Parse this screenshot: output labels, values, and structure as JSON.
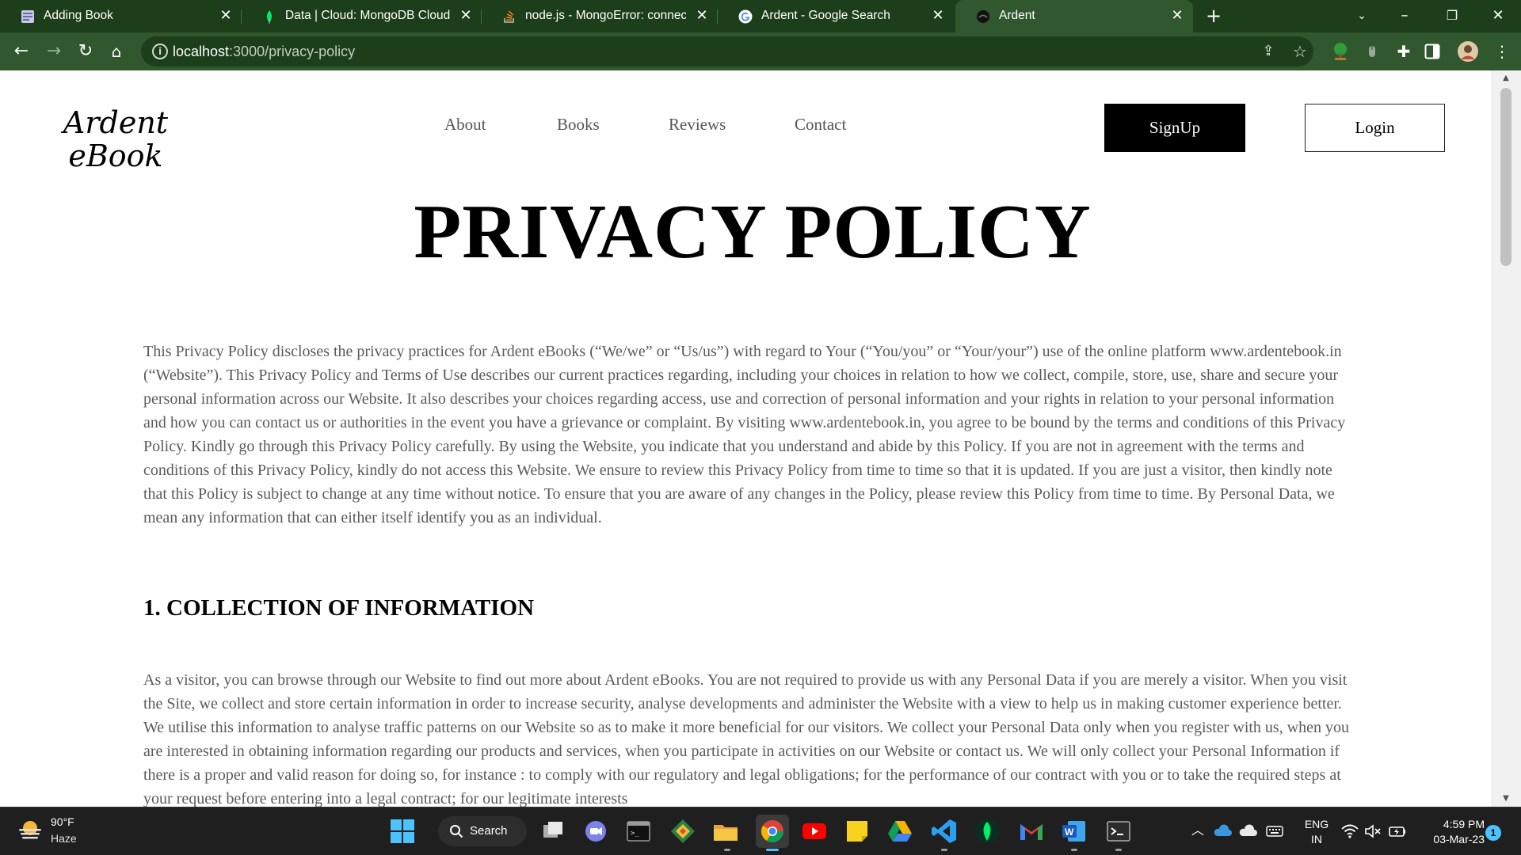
{
  "browser": {
    "tabs": [
      {
        "title": "Adding Book",
        "icon": "page-icon",
        "active": false
      },
      {
        "title": "Data | Cloud: MongoDB Cloud",
        "icon": "mongodb-leaf-icon",
        "active": false
      },
      {
        "title": "node.js - MongoError: connect ECONNREFUSED",
        "icon": "stackoverflow-icon",
        "active": false
      },
      {
        "title": "Ardent - Google Search",
        "icon": "google-icon",
        "active": false
      },
      {
        "title": "Ardent",
        "icon": "site-favicon",
        "active": true
      }
    ],
    "new_tab_label": "+",
    "close_glyph": "✕",
    "url_host": "localhost",
    "url_path": ":3000/privacy-policy",
    "theme_color": "#30572d",
    "tabstrip_color": "#1c3e1a"
  },
  "site": {
    "logo_line1": "Ardent",
    "logo_line2": "eBook",
    "nav": [
      "About",
      "Books",
      "Reviews",
      "Contact"
    ],
    "signup_label": "SignUp",
    "login_label": "Login"
  },
  "content": {
    "title": "PRIVACY POLICY",
    "intro": "This Privacy Policy discloses the privacy practices for Ardent eBooks (“We/we” or “Us/us”) with regard to Your (“You/you” or “Your/your”) use of the online platform www.ardentebook.in (“Website”). This Privacy Policy and Terms of Use describes our current practices regarding, including your choices in relation to how we collect, compile, store, use, share and secure your personal information across our Website. It also describes your choices regarding access, use and correction of personal information and your rights in relation to your personal information and how you can contact us or authorities in the event you have a grievance or complaint. By visiting www.ardentebook.in, you agree to be bound by the terms and conditions of this Privacy Policy. Kindly go through this Privacy Policy carefully. By using the Website, you indicate that you understand and abide by this Policy. If you are not in agreement with the terms and conditions of this Privacy Policy, kindly do not access this Website. We ensure to review this Privacy Policy from time to time so that it is updated. If you are just a visitor, then kindly note that this Policy is subject to change at any time without notice. To ensure that you are aware of any changes in the Policy, please review this Policy from time to time. By Personal Data, we mean any information that can either itself identify you as an individual.",
    "section1_heading": "1. COLLECTION OF INFORMATION",
    "section1_body": "As a visitor, you can browse through our Website to find out more about Ardent eBooks. You are not required to provide us with any Personal Data if you are merely a visitor. When you visit the Site, we collect and store certain information in order to increase security, analyse developments and administer the Website with a view to help us in making customer experience better. We utilise this information to analyse traffic patterns on our Website so as to make it more beneficial for our visitors. We collect your Personal Data only when you register with us, when you are interested in obtaining information regarding our products and services, when you participate in activities on our Website or contact us. We will only collect your Personal Information if there is a proper and valid reason for doing so, for instance : to comply with our regulatory and legal obligations; for the performance of our contract with you or to take the required steps at your request before entering into a legal contract; for our legitimate interests"
  },
  "taskbar": {
    "weather_temp": "90°F",
    "weather_condition": "Haze",
    "search_label": "Search",
    "lang_line1": "ENG",
    "lang_line2": "IN",
    "time": "4:59 PM",
    "date": "03-Mar-23",
    "notification_count": "1"
  }
}
